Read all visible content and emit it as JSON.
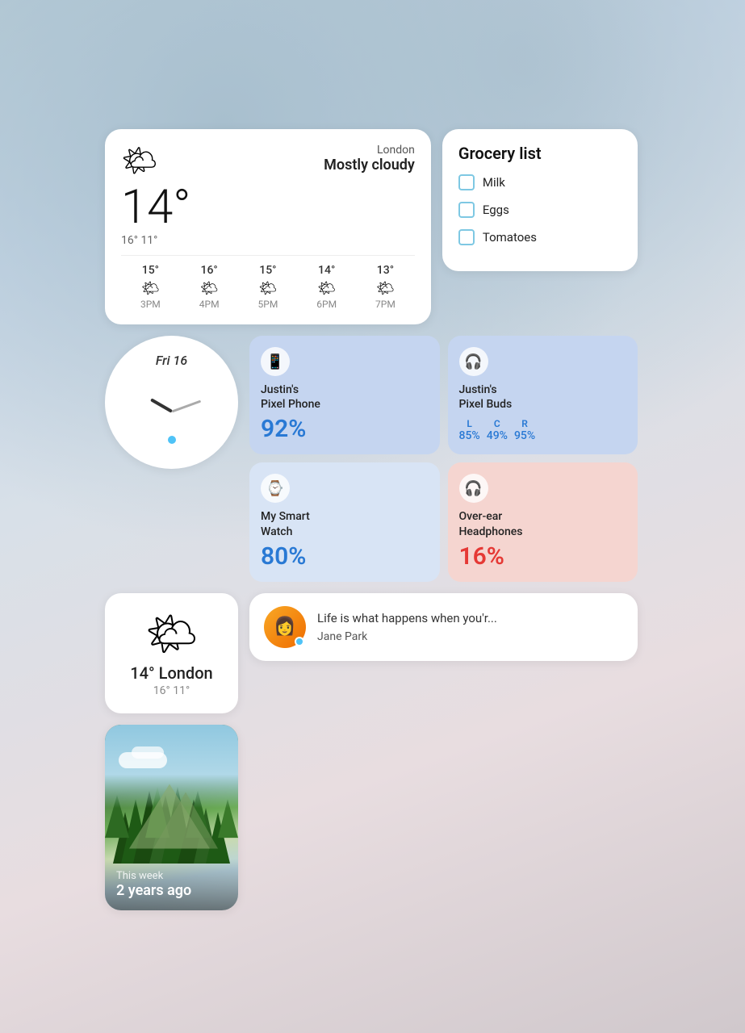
{
  "background": {
    "description": "blurry light blue/grey/pink abstract background"
  },
  "weather_widget": {
    "city": "London",
    "condition": "Mostly cloudy",
    "temp_main": "14°",
    "hi_lo": "16° 11°",
    "forecast": [
      {
        "temp": "15°",
        "icon": "🌤",
        "time": "3PM"
      },
      {
        "temp": "16°",
        "icon": "🌤",
        "time": "4PM"
      },
      {
        "temp": "15°",
        "icon": "🌤",
        "time": "5PM"
      },
      {
        "temp": "14°",
        "icon": "🌤",
        "time": "6PM"
      },
      {
        "temp": "13°",
        "icon": "🌤",
        "time": "7PM"
      }
    ]
  },
  "grocery_widget": {
    "title": "Grocery list",
    "items": [
      {
        "label": "Milk",
        "checked": false
      },
      {
        "label": "Eggs",
        "checked": false
      },
      {
        "label": "Tomatoes",
        "checked": false
      }
    ]
  },
  "clock_widget": {
    "date": "Fri 16",
    "dot_color": "#4fc3f7"
  },
  "device_cards": [
    {
      "name": "Justin's\nPixel Phone",
      "percentage": "92%",
      "color": "blue",
      "icon": "📱",
      "text_color": "blue-text"
    },
    {
      "name": "Justin's\nPixel Buds",
      "buds": true,
      "left": "85%",
      "center": "49%",
      "right": "95%",
      "color": "blue",
      "icon": "🎧",
      "text_color": "blue-text"
    },
    {
      "name": "My Smart\nWatch",
      "percentage": "80%",
      "color": "light-blue",
      "icon": "⌚",
      "text_color": "blue-text"
    },
    {
      "name": "Over-ear\nHeadphones",
      "percentage": "16%",
      "color": "pink",
      "icon": "🎧",
      "text_color": "red-text"
    }
  ],
  "weather_mini": {
    "icon": "🌤",
    "temp": "14° London",
    "hi_lo": "16° 11°"
  },
  "message_widget": {
    "avatar_emoji": "👩",
    "sender": "Jane Park",
    "message": "Life is what happens when you'r...",
    "online": true
  },
  "photo_widget": {
    "memory_label": "This week",
    "memory_time": "2 years ago"
  }
}
